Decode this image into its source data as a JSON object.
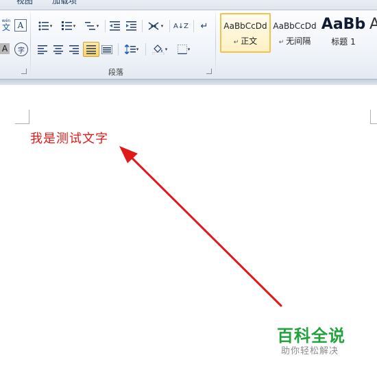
{
  "tabs": {
    "view": "视图",
    "addins": "加载项"
  },
  "ribbon": {
    "paragraph_group_label": "段落",
    "icons": {
      "phonetic": "wén",
      "phonetic_char": "文",
      "char_border": "A",
      "char_shade": "A",
      "enclose_char": "字",
      "sort": "A↓Z",
      "show_marks": "↵",
      "caret": "▾"
    }
  },
  "styles": {
    "items": [
      {
        "sample": "AaBbCcDd",
        "name": "正文",
        "prefix": "↵"
      },
      {
        "sample": "AaBbCcDd",
        "name": "无间隔",
        "prefix": "↵"
      },
      {
        "sample": "AaBb",
        "name": "标题 1"
      },
      {
        "sample": "A"
      }
    ]
  },
  "document": {
    "text": "我是测试文字",
    "text_color": "#e0191a"
  },
  "annotation": {
    "arrow_color": "#e0191a"
  },
  "watermark": {
    "title": "百科全说",
    "subtitle": "助你轻松解决",
    "color": "#22a23d"
  }
}
